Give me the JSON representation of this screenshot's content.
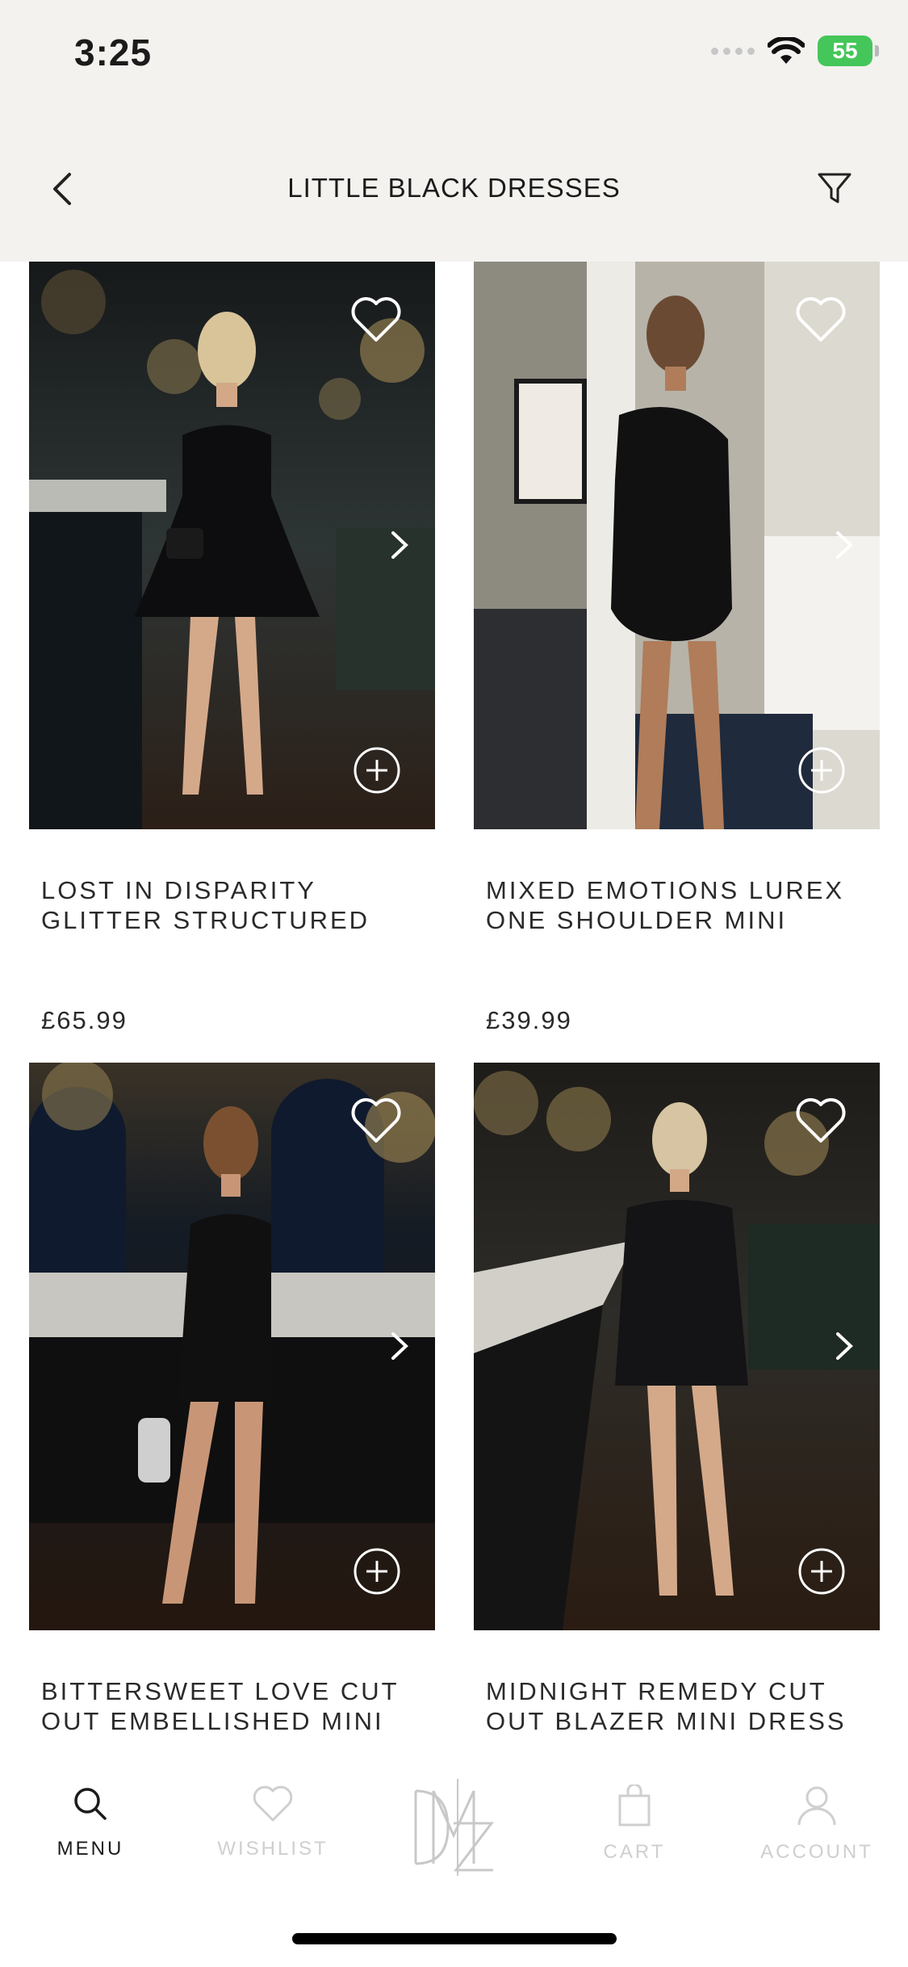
{
  "status_bar": {
    "time": "3:25",
    "battery": "55"
  },
  "header": {
    "title": "LITTLE BLACK DRESSES"
  },
  "products": [
    {
      "name": "LOST IN DISPARITY GLITTER STRUCTURED",
      "price": "£65.99"
    },
    {
      "name": "MIXED EMOTIONS LUREX ONE SHOULDER MINI",
      "price": "£39.99"
    },
    {
      "name": "BITTERSWEET LOVE CUT OUT EMBELLISHED MINI",
      "price": ""
    },
    {
      "name": "MIDNIGHT REMEDY CUT OUT BLAZER MINI DRESS",
      "price": ""
    }
  ],
  "tabbar": {
    "menu": "MENU",
    "wishlist": "WISHLIST",
    "cart": "CART",
    "account": "ACCOUNT"
  },
  "colors": {
    "header_bg": "#f3f2ef",
    "battery": "#45c65a",
    "tab_inactive": "#cfcfcf"
  }
}
